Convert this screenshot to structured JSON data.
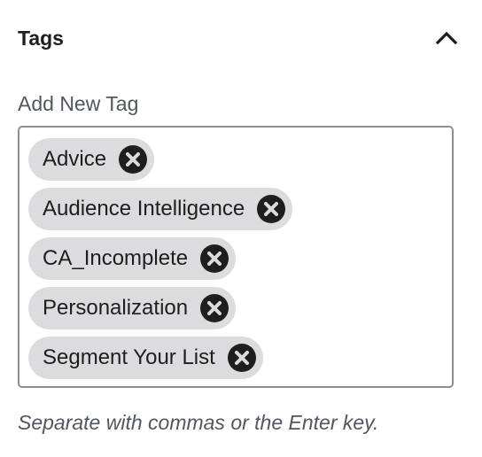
{
  "panel": {
    "title": "Tags",
    "toggle_icon": "chevron-up-icon"
  },
  "field": {
    "label": "Add New Tag",
    "help_text": "Separate with commas or the Enter key."
  },
  "tags": [
    {
      "label": "Advice",
      "remove_icon": "close-circle-icon"
    },
    {
      "label": "Audience Intelligence",
      "remove_icon": "close-circle-icon"
    },
    {
      "label": "CA_Incomplete",
      "remove_icon": "close-circle-icon"
    },
    {
      "label": "Personalization",
      "remove_icon": "close-circle-icon"
    },
    {
      "label": "Segment Your List",
      "remove_icon": "close-circle-icon"
    }
  ],
  "colors": {
    "text": "#1e1e1e",
    "muted_text": "#50575e",
    "token_bg": "#dcdcde",
    "border": "#8c8f94"
  }
}
